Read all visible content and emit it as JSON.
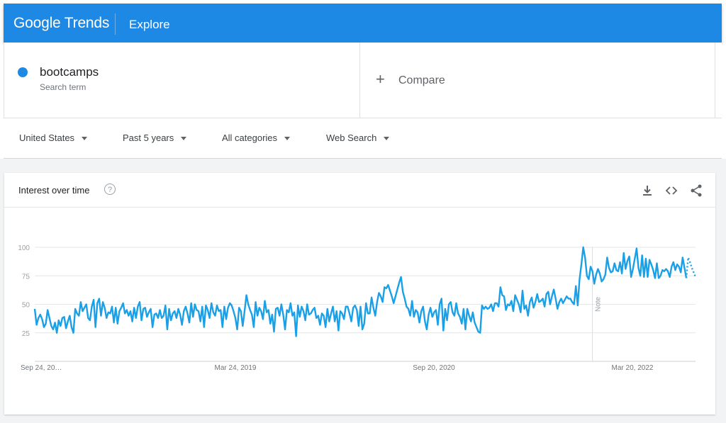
{
  "header": {
    "logo_google": "Google",
    "logo_trends": "Trends",
    "section": "Explore",
    "bar_color": "#1e88e5"
  },
  "search_terms": [
    {
      "term": "bootcamps",
      "subtitle": "Search term",
      "color": "#1e88e5"
    }
  ],
  "compare": {
    "icon": "plus-icon",
    "label": "Compare"
  },
  "filters": [
    {
      "label": "United States"
    },
    {
      "label": "Past 5 years"
    },
    {
      "label": "All categories"
    },
    {
      "label": "Web Search"
    }
  ],
  "card": {
    "title": "Interest over time",
    "help_icon": "?",
    "tools": [
      "download-icon",
      "embed-icon",
      "share-icon"
    ]
  },
  "chart_data": {
    "type": "line",
    "y_ticks": [
      "100",
      "75",
      "50",
      "25"
    ],
    "ylim": [
      0,
      100
    ],
    "x_tick_labels": [
      "Sep 24, 20…",
      "Mar 24, 2019",
      "Sep 20, 2020",
      "Mar 20, 2022"
    ],
    "note_label": "Note",
    "series": [
      {
        "color": "#1aa0e6",
        "values": [
          46,
          32,
          38,
          41,
          37,
          30,
          33,
          45,
          38,
          31,
          28,
          34,
          25,
          36,
          31,
          38,
          39,
          29,
          35,
          40,
          30,
          25,
          46,
          42,
          40,
          52,
          44,
          47,
          50,
          38,
          36,
          48,
          54,
          30,
          51,
          55,
          40,
          52,
          47,
          38,
          43,
          42,
          48,
          34,
          47,
          33,
          44,
          47,
          51,
          42,
          45,
          40,
          44,
          35,
          47,
          38,
          48,
          52,
          36,
          46,
          47,
          39,
          43,
          46,
          30,
          41,
          42,
          38,
          45,
          38,
          40,
          49,
          28,
          46,
          36,
          42,
          44,
          38,
          46,
          41,
          32,
          44,
          48,
          42,
          34,
          51,
          39,
          50,
          45,
          44,
          35,
          48,
          30,
          49,
          45,
          38,
          51,
          43,
          40,
          49,
          44,
          45,
          30,
          48,
          37,
          47,
          51,
          49,
          44,
          38,
          28,
          47,
          44,
          31,
          44,
          58,
          50,
          45,
          41,
          30,
          52,
          40,
          47,
          44,
          37,
          53,
          43,
          45,
          33,
          41,
          26,
          46,
          47,
          40,
          50,
          41,
          28,
          45,
          43,
          51,
          40,
          43,
          22,
          49,
          39,
          48,
          44,
          36,
          50,
          41,
          42,
          45,
          47,
          38,
          40,
          32,
          42,
          40,
          30,
          46,
          35,
          42,
          48,
          35,
          44,
          27,
          44,
          42,
          37,
          48,
          48,
          42,
          35,
          47,
          49,
          45,
          31,
          48,
          28,
          33,
          51,
          42,
          42,
          56,
          47,
          40,
          52,
          60,
          57,
          52,
          65,
          64,
          67,
          62,
          57,
          51,
          57,
          63,
          69,
          74,
          61,
          55,
          48,
          46,
          40,
          53,
          39,
          45,
          43,
          34,
          44,
          48,
          35,
          28,
          41,
          47,
          39,
          43,
          45,
          32,
          50,
          55,
          27,
          46,
          36,
          50,
          52,
          43,
          40,
          51,
          42,
          39,
          33,
          46,
          28,
          46,
          40,
          35,
          43,
          34,
          30,
          26,
          25,
          49,
          46,
          48,
          46,
          47,
          50,
          44,
          51,
          51,
          48,
          65,
          58,
          57,
          45,
          50,
          49,
          53,
          44,
          58,
          54,
          50,
          43,
          62,
          46,
          49,
          40,
          52,
          56,
          47,
          52,
          59,
          52,
          53,
          55,
          48,
          59,
          61,
          50,
          57,
          63,
          55,
          46,
          52,
          55,
          51,
          54,
          57,
          55,
          55,
          52,
          50,
          66,
          49,
          72,
          85,
          100,
          91,
          75,
          72,
          83,
          79,
          68,
          76,
          81,
          77,
          70,
          72,
          76,
          91,
          82,
          78,
          79,
          86,
          80,
          79,
          87,
          77,
          95,
          81,
          88,
          92,
          74,
          81,
          90,
          99,
          82,
          75,
          93,
          74,
          90,
          74,
          89,
          85,
          80,
          73,
          86,
          73,
          75,
          80,
          79,
          81,
          79,
          74,
          83,
          87,
          80,
          85,
          83,
          78,
          91,
          82,
          73
        ]
      }
    ],
    "forecast_values": [
      91,
      87,
      82,
      78,
      74
    ]
  }
}
